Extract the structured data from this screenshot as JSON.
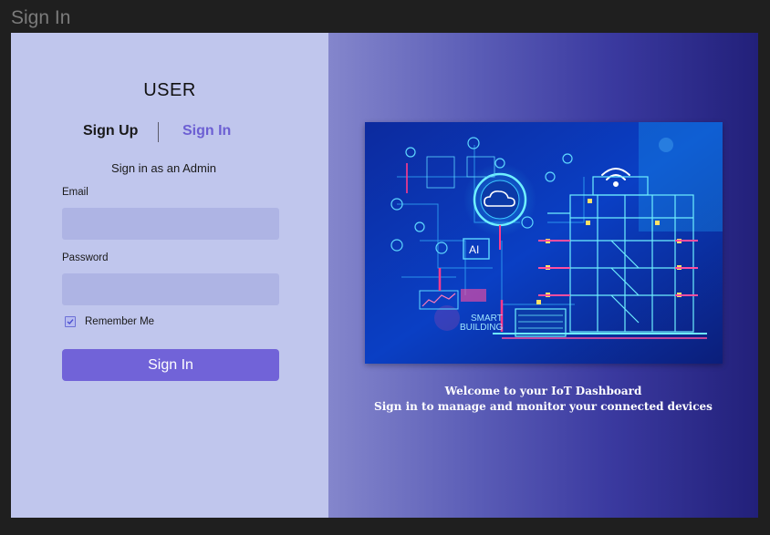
{
  "window": {
    "title": "Sign In"
  },
  "login": {
    "heading": "USER",
    "tabs": [
      {
        "label": "Sign Up",
        "active": false
      },
      {
        "label": "Sign In",
        "active": true
      }
    ],
    "subtitle": "Sign in as an Admin",
    "email": {
      "label": "Email",
      "value": "",
      "placeholder": ""
    },
    "password": {
      "label": "Password",
      "value": "",
      "placeholder": ""
    },
    "remember": {
      "label": "Remember Me",
      "checked": true
    },
    "submit_label": "Sign In"
  },
  "hero": {
    "illustration": {
      "text_line1": "SMART",
      "text_line2": "BUILDING",
      "ai_label": "AI",
      "icons": [
        "cloud-icon",
        "wifi-icon",
        "building-icon"
      ]
    },
    "welcome_line1": "Welcome to your IoT Dashboard",
    "welcome_line2": "Sign in to manage and monitor your connected devices"
  },
  "colors": {
    "left_panel": "#c0c6ed",
    "input_bg": "#aeb4e4",
    "accent": "#7163d8",
    "active_tab": "#6c5fd3",
    "hero_gradient_start": "#8486cc",
    "hero_gradient_end": "#22207a"
  }
}
